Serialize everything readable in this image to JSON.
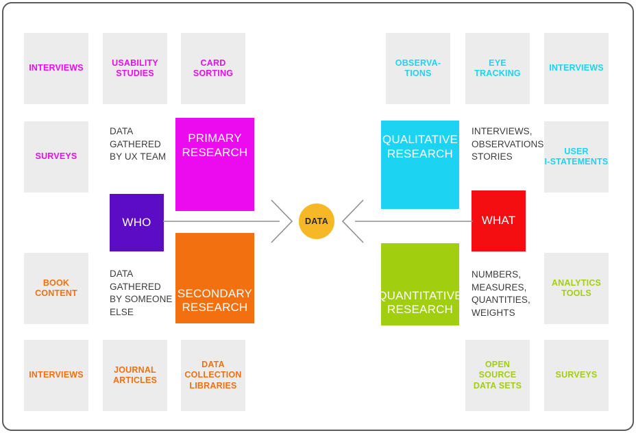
{
  "diagram": {
    "title": "DATA",
    "center_label": "DATA",
    "colors": {
      "chip_bg": "#ececec",
      "magenta": "#eb0bee",
      "purple": "#5b0cc4",
      "orange": "#f2700f",
      "cyan": "#1dd3f2",
      "green": "#a2ce10",
      "red": "#f40e11",
      "amber": "#f6b827",
      "note_text": "#3b3b3b",
      "frame": "#5a5a5a"
    },
    "left_branch": {
      "label": "WHO",
      "primary": {
        "label": "PRIMARY RESEARCH",
        "note": "DATA GATHERED BY UX TEAM",
        "sources": [
          "INTERVIEWS",
          "USABILITY STUDIES",
          "CARD SORTING",
          "SURVEYS"
        ]
      },
      "secondary": {
        "label": "SECONDARY RESEARCH",
        "note": "DATA GATHERED BY SOMEONE ELSE",
        "sources": [
          "BOOK CONTENT",
          "INTERVIEWS",
          "JOURNAL ARTICLES",
          "DATA COLLECTION LIBRARIES"
        ]
      }
    },
    "right_branch": {
      "label": "WHAT",
      "qualitative": {
        "label": "QUALITATIVE RESEARCH",
        "note": "INTERVIEWS, OBSERVATIONS, STORIES",
        "sources": [
          "OBSERVA- TIONS",
          "EYE TRACKING",
          "INTERVIEWS",
          "USER I-STATEMENTS"
        ]
      },
      "quantitative": {
        "label": "QUANTITATIVE RESEARCH",
        "note": "NUMBERS, MEASURES, QUANTITIES, WEIGHTS",
        "sources": [
          "ANALYTICS TOOLS",
          "OPEN SOURCE DATA SETS",
          "SURVEYS"
        ]
      }
    },
    "chips": {
      "interviews_magenta": "INTERVIEWS",
      "usability_studies": "USABILITY\nSTUDIES",
      "card_sorting": "CARD\nSORTING",
      "surveys_magenta": "SURVEYS",
      "book_content": "BOOK\nCONTENT",
      "interviews_orange": "INTERVIEWS",
      "journal_articles": "JOURNAL\nARTICLES",
      "data_collection_libraries": "DATA\nCOLLECTION\nLIBRARIES",
      "observations": "OBSERVA-\nTIONS",
      "eye_tracking": "EYE\nTRACKING",
      "interviews_cyan": "INTERVIEWS",
      "user_i_statements": "USER\nI-STATEMENTS",
      "analytics_tools": "ANALYTICS\nTOOLS",
      "open_source_data_sets": "OPEN\nSOURCE\nDATA SETS",
      "surveys_green": "SURVEYS"
    },
    "solids": {
      "primary_research": "PRIMARY\nRESEARCH",
      "secondary_research": "SECONDARY\nRESEARCH",
      "qualitative_research": "QUALITATIVE\nRESEARCH",
      "quantitative_research": "QUANTITATIVE\nRESEARCH",
      "who": "WHO",
      "what": "WHAT"
    },
    "notes": {
      "primary_note": "DATA\nGATHERED\nBY UX TEAM",
      "secondary_note": "DATA\nGATHERED\nBY SOMEONE\nELSE",
      "qualitative_note": "INTERVIEWS,\nOBSERVATIONS,\nSTORIES",
      "quantitative_note": "NUMBERS,\nMEASURES,\nQUANTITIES,\nWEIGHTS"
    }
  }
}
